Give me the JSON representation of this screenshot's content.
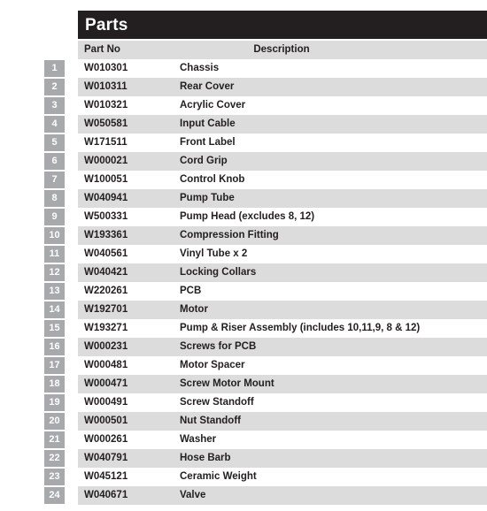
{
  "panel": {
    "title": "Parts"
  },
  "table": {
    "columns": {
      "index": "",
      "part_no": "Part No",
      "description": "Description"
    },
    "rows": [
      {
        "no": "1",
        "part_no": "W010301",
        "description": "Chassis"
      },
      {
        "no": "2",
        "part_no": "W010311",
        "description": "Rear Cover"
      },
      {
        "no": "3",
        "part_no": "W010321",
        "description": "Acrylic Cover"
      },
      {
        "no": "4",
        "part_no": "W050581",
        "description": "Input Cable"
      },
      {
        "no": "5",
        "part_no": "W171511",
        "description": "Front Label"
      },
      {
        "no": "6",
        "part_no": "W000021",
        "description": "Cord Grip"
      },
      {
        "no": "7",
        "part_no": "W100051",
        "description": "Control Knob"
      },
      {
        "no": "8",
        "part_no": "W040941",
        "description": "Pump Tube"
      },
      {
        "no": "9",
        "part_no": "W500331",
        "description": "Pump Head (excludes 8, 12)"
      },
      {
        "no": "10",
        "part_no": "W193361",
        "description": "Compression Fitting"
      },
      {
        "no": "11",
        "part_no": "W040561",
        "description": "Vinyl Tube x 2"
      },
      {
        "no": "12",
        "part_no": "W040421",
        "description": "Locking Collars"
      },
      {
        "no": "13",
        "part_no": "W220261",
        "description": "PCB"
      },
      {
        "no": "14",
        "part_no": "W192701",
        "description": "Motor"
      },
      {
        "no": "15",
        "part_no": "W193271",
        "description": "Pump & Riser Assembly (includes 10,11,9, 8 & 12)"
      },
      {
        "no": "16",
        "part_no": "W000231",
        "description": "Screws for PCB"
      },
      {
        "no": "17",
        "part_no": "W000481",
        "description": "Motor Spacer"
      },
      {
        "no": "18",
        "part_no": "W000471",
        "description": "Screw Motor Mount"
      },
      {
        "no": "19",
        "part_no": "W000491",
        "description": "Screw Standoff"
      },
      {
        "no": "20",
        "part_no": "W000501",
        "description": "Nut Standoff"
      },
      {
        "no": "21",
        "part_no": "W000261",
        "description": "Washer"
      },
      {
        "no": "22",
        "part_no": "W040791",
        "description": "Hose Barb"
      },
      {
        "no": "23",
        "part_no": "W045121",
        "description": "Ceramic Weight"
      },
      {
        "no": "24",
        "part_no": "W040671",
        "description": "Valve"
      }
    ]
  },
  "colors": {
    "title_bar": "#231f20",
    "header_row": "#dcdcdd",
    "row_alt": "#dcdcdd",
    "row_base": "#ffffff",
    "badge": "#a7a9ac",
    "text": "#231f20"
  }
}
